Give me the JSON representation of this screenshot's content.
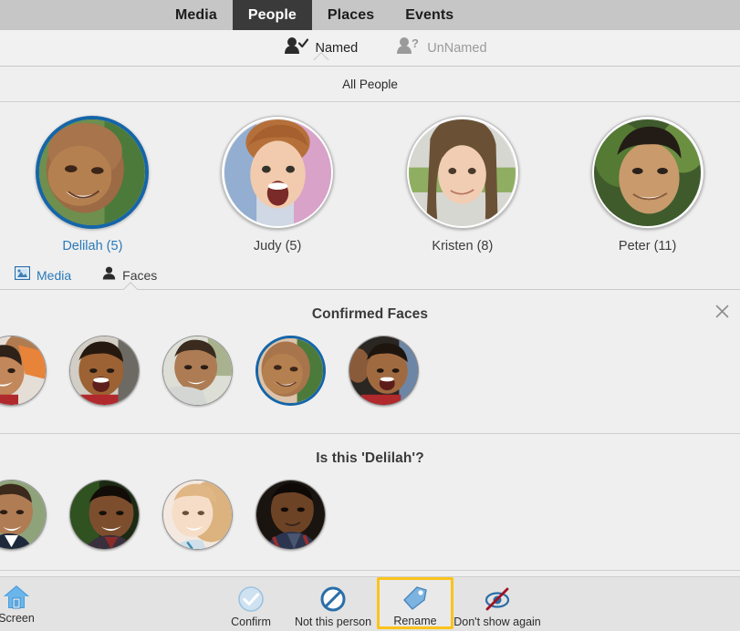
{
  "top_tabs": [
    {
      "label": "Media",
      "active": false
    },
    {
      "label": "People",
      "active": true
    },
    {
      "label": "Places",
      "active": false
    },
    {
      "label": "Events",
      "active": false
    }
  ],
  "named_bar": {
    "named_label": "Named",
    "unnamed_label": "UnNamed",
    "named_icon": "person-check-icon",
    "unnamed_icon": "person-question-icon",
    "active": "Named"
  },
  "filter_bar": {
    "label": "All People"
  },
  "people": [
    {
      "name": "Delilah",
      "count": "(5)",
      "label": "Delilah (5)",
      "selected": true
    },
    {
      "name": "Judy",
      "count": "(5)",
      "label": "Judy (5)",
      "selected": false
    },
    {
      "name": "Kristen",
      "count": "(8)",
      "label": "Kristen (8)",
      "selected": false
    },
    {
      "name": "Peter",
      "count": "(11)",
      "label": "Peter (11)",
      "selected": false
    }
  ],
  "subtabs": [
    {
      "label": "Media",
      "icon": "photo-icon",
      "active": false
    },
    {
      "label": "Faces",
      "icon": "person-icon",
      "active": true
    }
  ],
  "confirmed_panel": {
    "title": "Confirmed Faces",
    "close_icon": "close-icon",
    "faces": [
      {
        "id": "face-1",
        "selected": false
      },
      {
        "id": "face-2",
        "selected": false
      },
      {
        "id": "face-3",
        "selected": false
      },
      {
        "id": "face-4",
        "selected": true
      },
      {
        "id": "face-5",
        "selected": false
      }
    ]
  },
  "suggest_panel": {
    "title": "Is this 'Delilah'?",
    "faces": [
      {
        "id": "sug-1",
        "selected": false
      },
      {
        "id": "sug-2",
        "selected": false
      },
      {
        "id": "sug-3",
        "selected": false
      },
      {
        "id": "sug-4",
        "selected": false
      }
    ]
  },
  "bottom_toolbar": {
    "home_label": "Screen",
    "home_icon": "home-icon",
    "actions": [
      {
        "label": "Confirm",
        "icon": "check-circle-icon",
        "highlighted": false
      },
      {
        "label": "Not this person",
        "icon": "no-entry-icon",
        "highlighted": false
      },
      {
        "label": "Rename",
        "icon": "tag-icon",
        "highlighted": true
      },
      {
        "label": "Don't show again",
        "icon": "hide-icon",
        "highlighted": false
      }
    ]
  },
  "colors": {
    "topbar_bg": "#c6c6c6",
    "active_tab_bg": "#3a3a3a",
    "page_bg": "#efefef",
    "selection_blue": "#1565a8",
    "link_blue": "#2a7ab9",
    "highlight_gold": "#fcc21b",
    "toolbar_bg": "#e3e3e3"
  }
}
